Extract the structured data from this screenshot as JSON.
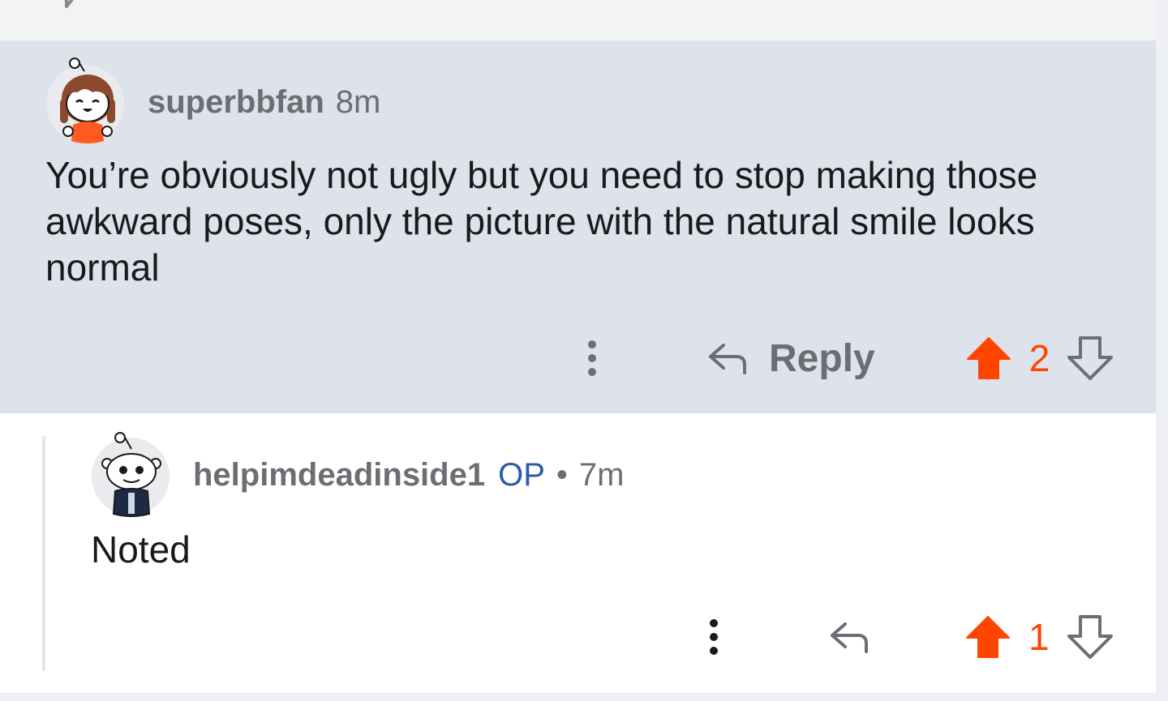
{
  "comments": [
    {
      "username": "superbbfan",
      "timestamp": "8m",
      "body": "You’re obviously not ugly but you need to stop making those awkward poses, only the picture with the natural smile looks normal",
      "reply_label": "Reply",
      "score": "2",
      "upvoted": true
    },
    {
      "username": "helpimdeadinside1",
      "op_badge": "OP",
      "separator": "•",
      "timestamp": "7m",
      "body": "Noted",
      "score": "1",
      "upvoted": true
    }
  ],
  "colors": {
    "upvote": "#ff4500",
    "op_badge": "#2d5ba8",
    "highlight_bg": "#dde2eb",
    "meta_text": "#6b6e73"
  },
  "icons": [
    "chat-icon",
    "more-vertical-icon",
    "reply-arrow-icon",
    "upvote-arrow-icon",
    "downvote-arrow-icon",
    "avatar-girl-icon",
    "avatar-snoo-icon"
  ]
}
